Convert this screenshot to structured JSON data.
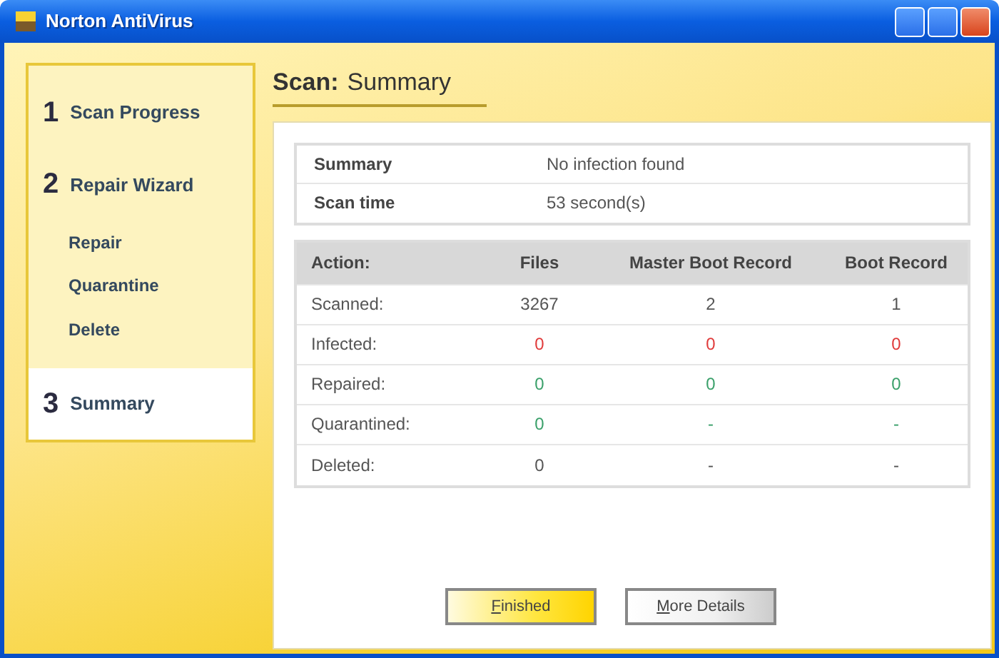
{
  "window": {
    "title": "Norton AntiVirus"
  },
  "sidebar": {
    "items": [
      {
        "kind": "step",
        "number": "1",
        "label": "Scan Progress",
        "selected": false
      },
      {
        "kind": "step",
        "number": "2",
        "label": "Repair Wizard",
        "selected": false
      },
      {
        "kind": "sub",
        "label": "Repair",
        "selected": false
      },
      {
        "kind": "sub",
        "label": "Quarantine",
        "selected": false
      },
      {
        "kind": "sub",
        "label": "Delete",
        "selected": false
      },
      {
        "kind": "step",
        "number": "3",
        "label": "Summary",
        "selected": true
      }
    ]
  },
  "heading": {
    "prefix": "Scan:",
    "title": "Summary"
  },
  "summary": [
    {
      "label": "Summary",
      "value": "No infection found"
    },
    {
      "label": "Scan time",
      "value": "53 second(s)"
    }
  ],
  "table": {
    "columns": [
      "Action:",
      "Files",
      "Master Boot Record",
      "Boot Record"
    ],
    "rows": [
      {
        "kind": "plain",
        "cells": [
          "Scanned:",
          "3267",
          "2",
          "1"
        ]
      },
      {
        "kind": "bad",
        "cells": [
          "Infected:",
          "0",
          "0",
          "0"
        ]
      },
      {
        "kind": "good",
        "cells": [
          "Repaired:",
          "0",
          "0",
          "0"
        ]
      },
      {
        "kind": "good",
        "cells": [
          "Quarantined:",
          "0",
          "-",
          "-"
        ]
      },
      {
        "kind": "plain",
        "cells": [
          "Deleted:",
          "0",
          "-",
          "-"
        ]
      }
    ]
  },
  "buttons": [
    {
      "label": "Finished",
      "kind": "primary"
    },
    {
      "label": "More Details",
      "kind": "secondary"
    }
  ]
}
